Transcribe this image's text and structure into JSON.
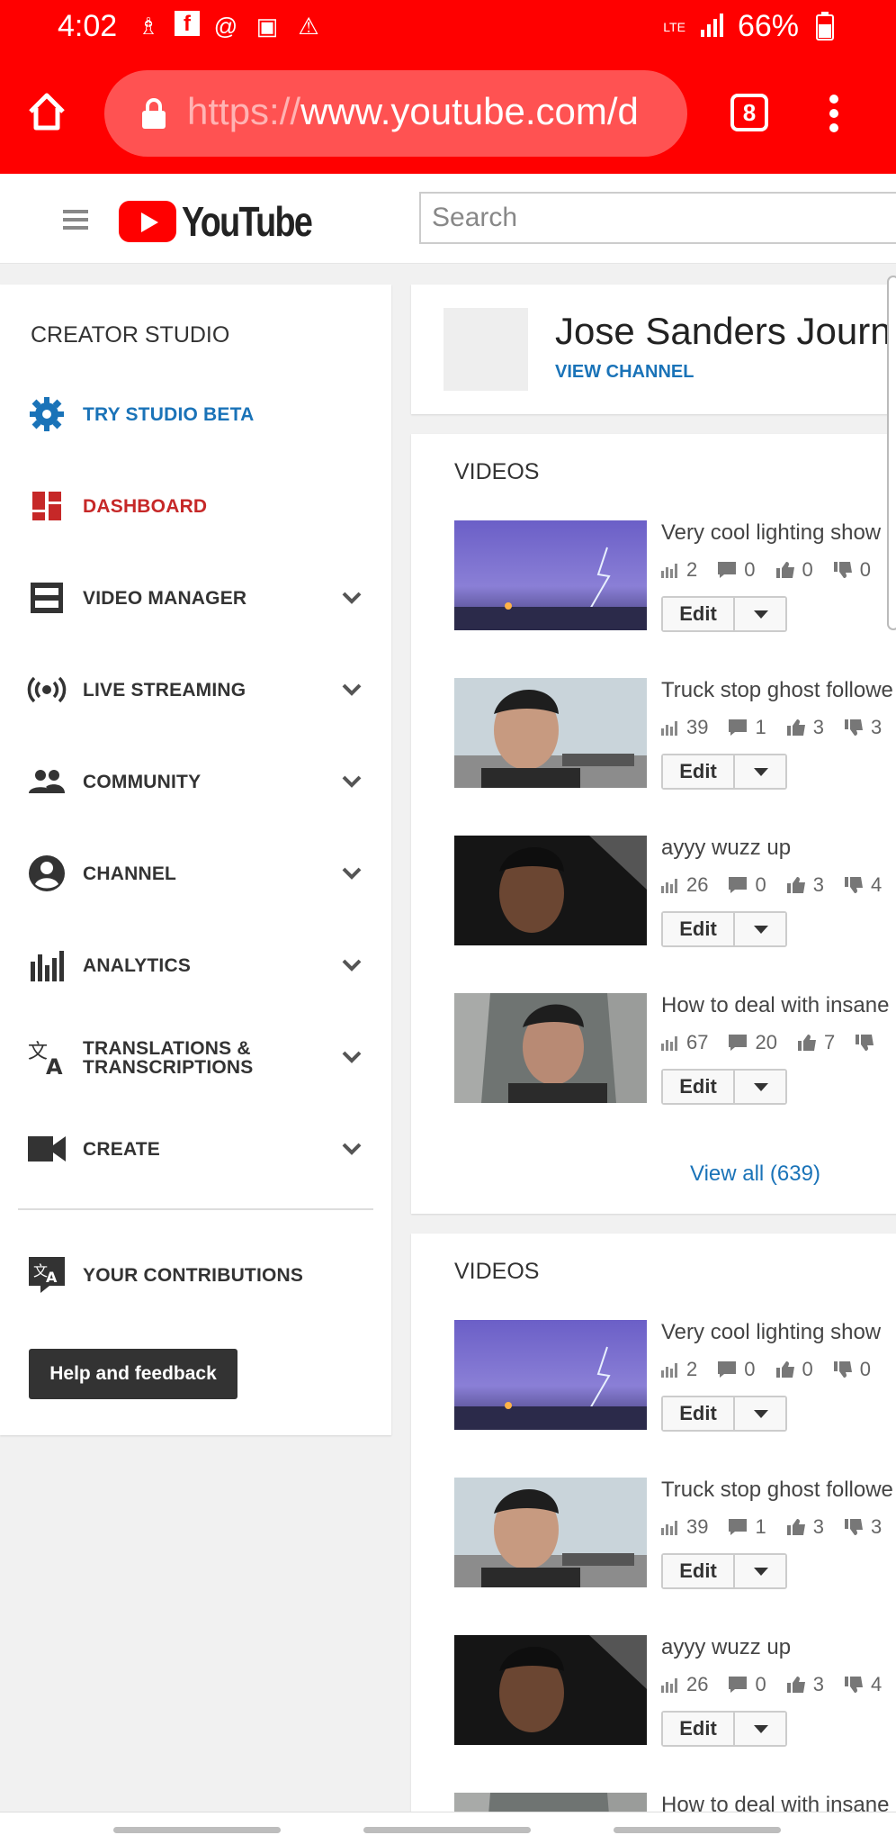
{
  "status_bar": {
    "time": "4:02",
    "network": "LTE",
    "battery": "66%"
  },
  "browser": {
    "url_scheme": "https://",
    "url_rest": "www.youtube.com/d",
    "tab_count": "8"
  },
  "youtube": {
    "logo_text": "YouTube",
    "search_placeholder": "Search"
  },
  "sidebar": {
    "title": "CREATOR STUDIO",
    "items": [
      {
        "label": "TRY STUDIO BETA",
        "icon": "gear-icon"
      },
      {
        "label": "DASHBOARD",
        "icon": "dashboard-icon"
      },
      {
        "label": "VIDEO MANAGER",
        "icon": "video-manager-icon"
      },
      {
        "label": "LIVE STREAMING",
        "icon": "live-streaming-icon"
      },
      {
        "label": "COMMUNITY",
        "icon": "people-icon"
      },
      {
        "label": "CHANNEL",
        "icon": "account-icon"
      },
      {
        "label": "ANALYTICS",
        "icon": "bar-chart-icon"
      },
      {
        "label": "TRANSLATIONS &",
        "label2": "TRANSCRIPTIONS",
        "icon": "translate-icon"
      },
      {
        "label": "CREATE",
        "icon": "video-camera-icon"
      }
    ],
    "contributions_label": "YOUR CONTRIBUTIONS",
    "help_label": "Help and feedback"
  },
  "channel": {
    "name": "Jose Sanders Journe",
    "view_channel": "VIEW CHANNEL"
  },
  "videos_sections": [
    {
      "title": "VIDEOS",
      "videos": [
        {
          "title": "Very cool lighting show",
          "views": "2",
          "comments": "0",
          "likes": "0",
          "dislikes": "0"
        },
        {
          "title": "Truck stop ghost followe",
          "views": "39",
          "comments": "1",
          "likes": "3",
          "dislikes": "3"
        },
        {
          "title": "ayyy wuzz up",
          "views": "26",
          "comments": "0",
          "likes": "3",
          "dislikes": "4"
        },
        {
          "title": "How to deal with insane",
          "views": "67",
          "comments": "20",
          "likes": "7",
          "dislikes": ""
        }
      ],
      "view_all": "View all (639)"
    },
    {
      "title": "VIDEOS",
      "videos": [
        {
          "title": "Very cool lighting show",
          "views": "2",
          "comments": "0",
          "likes": "0",
          "dislikes": "0"
        },
        {
          "title": "Truck stop ghost followe",
          "views": "39",
          "comments": "1",
          "likes": "3",
          "dislikes": "3"
        },
        {
          "title": "ayyy wuzz up",
          "views": "26",
          "comments": "0",
          "likes": "3",
          "dislikes": "4"
        },
        {
          "title": "How to deal with insane"
        }
      ]
    }
  ],
  "edit_label": "Edit",
  "colors": {
    "brand_red": "#ff0000",
    "link_blue": "#1a73b8",
    "dashboard_red": "#c62828"
  }
}
